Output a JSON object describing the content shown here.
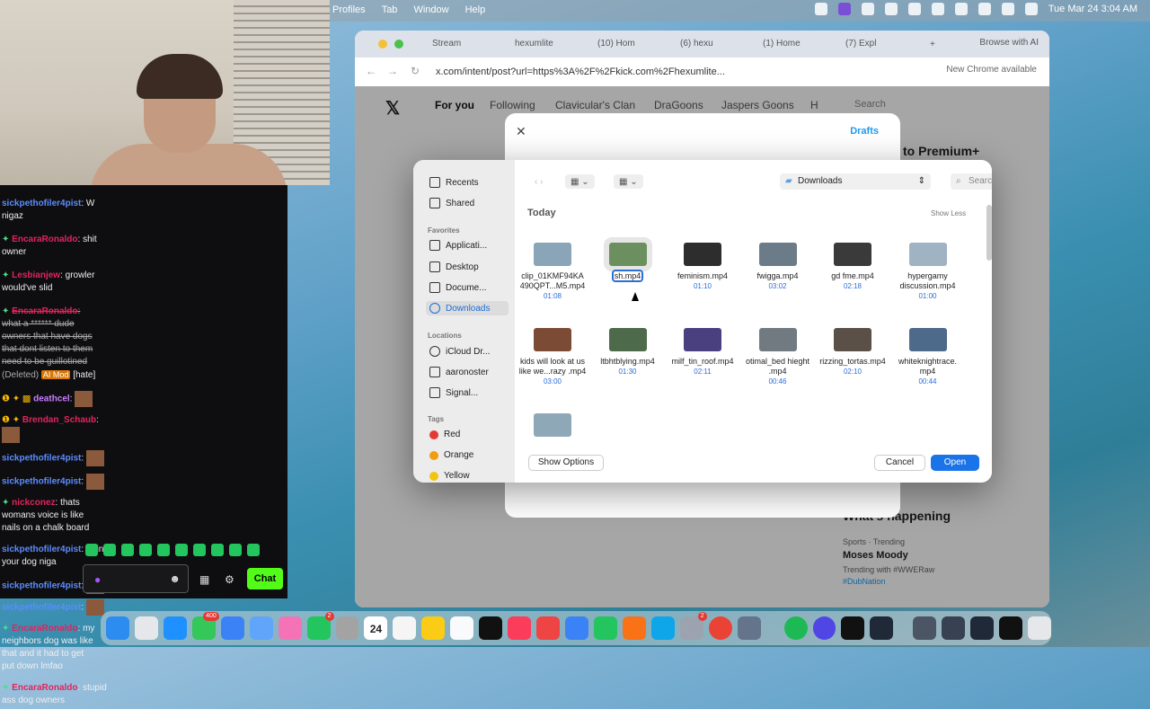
{
  "menubar": {
    "items": [
      "Profiles",
      "Tab",
      "Window",
      "Help"
    ],
    "datetime": "Tue Mar 24  3:04 AM"
  },
  "chat": {
    "messages": [
      {
        "user": "sickpethofiler4pist",
        "text": ": W nigaz",
        "color": "#5b8cff"
      },
      {
        "user": "EncaraRonaldo",
        "text": ": shit owner",
        "color": "#e0245e"
      },
      {
        "user": "Lesbianjew",
        "text": ": growler would've slid",
        "color": "#e0245e"
      },
      {
        "user": "EncaraRonaldo",
        "text": ": what a ****** dude owners that have dogs that dont listen to them need to be guillotined",
        "deleted": "(Deleted)",
        "mod": "AI Mod",
        "tag": "[hate]",
        "color": "#e0245e"
      },
      {
        "user": "deathcel",
        "text": ":",
        "color": "#c77dff"
      },
      {
        "user": "Brendan_Schaub",
        "text": ":",
        "color": "#e0245e"
      },
      {
        "user": "sickpethofiler4pist",
        "text": ":",
        "color": "#5b8cff"
      },
      {
        "user": "sickpethofiler4pist",
        "text": ":",
        "color": "#5b8cff"
      },
      {
        "user": "nickconez",
        "text": ": thats womans voice is like nails on a chalk board",
        "color": "#e0245e"
      },
      {
        "user": "sickpethofiler4pist",
        "text": ": train your dog niga",
        "color": "#5b8cff"
      },
      {
        "user": "sickpethofiler4pist",
        "text": ":",
        "color": "#5b8cff"
      },
      {
        "user": "sickpethofiler4pist",
        "text": ":",
        "color": "#5b8cff"
      },
      {
        "user": "EncaraRonaldo",
        "text": ": my neighbors dog was like that and it had to get put down lmfao",
        "color": "#e0245e"
      },
      {
        "user": "EncaraRonaldo",
        "text": ": stupid ass dog owners",
        "color": "#e0245e"
      }
    ],
    "chat_button": "Chat"
  },
  "browser": {
    "tabs": [
      "Stream",
      "hexumlite",
      "(10) Hom",
      "(6) hexu",
      "(1) Home",
      "(7) Expl"
    ],
    "browse_ai": "Browse with AI",
    "url": "x.com/intent/post?url=https%3A%2F%2Fkick.com%2Fhexumlite...",
    "new_chrome": "New Chrome available",
    "x_tabs": [
      "For you",
      "Following",
      "Clavicular's Clan",
      "DraGoons",
      "Jaspers Goons",
      "H"
    ],
    "search_placeholder": "Search",
    "drafts": "Drafts",
    "premium": "to Premium+",
    "whats_happening": "What's happening",
    "trend_meta": "Sports · Trending",
    "trend_title": "Moses Moody",
    "trend_with": "Trending with #WWERaw",
    "trend_tag": "#DubNation"
  },
  "dialog": {
    "sidebar": {
      "recents": "Recents",
      "shared": "Shared",
      "favorites_head": "Favorites",
      "favorites": [
        "Applicati...",
        "Desktop",
        "Docume...",
        "Downloads"
      ],
      "locations_head": "Locations",
      "locations": [
        "iCloud Dr...",
        "aaronoster",
        "Signal..."
      ],
      "tags_head": "Tags",
      "tags": [
        {
          "label": "Red",
          "color": "#e53935"
        },
        {
          "label": "Orange",
          "color": "#f39c12"
        },
        {
          "label": "Yellow",
          "color": "#f1c40f"
        }
      ]
    },
    "location": "Downloads",
    "search_placeholder": "Search",
    "section": "Today",
    "show_less": "Show Less",
    "files": [
      {
        "name": "clip_01KMF94KA 490QPT...M5.mp4",
        "dur": "01:08"
      },
      {
        "name": "sh.mp4",
        "dur": ""
      },
      {
        "name": "feminism.mp4",
        "dur": "01:10"
      },
      {
        "name": "fwigga.mp4",
        "dur": "03:02"
      },
      {
        "name": "gd fme.mp4",
        "dur": "02:18"
      },
      {
        "name": "hypergamy discussion.mp4",
        "dur": "01:00"
      },
      {
        "name": "kids will look at us like we...razy .mp4",
        "dur": "03:00"
      },
      {
        "name": "ltbhtblying.mp4",
        "dur": "01:30"
      },
      {
        "name": "milf_tin_roof.mp4",
        "dur": "02:11"
      },
      {
        "name": "otimal_bed hieght .mp4",
        "dur": "00:46"
      },
      {
        "name": "rizzing_tortas.mp4",
        "dur": "02:10"
      },
      {
        "name": "whiteknightrace. mp4",
        "dur": "00:44"
      },
      {
        "name": "",
        "dur": ""
      }
    ],
    "show_options": "Show Options",
    "cancel": "Cancel",
    "open": "Open"
  },
  "dock": {
    "badges": {
      "messages": "400",
      "facetime": "2",
      "settings": "2"
    },
    "calendar_day": "24"
  }
}
